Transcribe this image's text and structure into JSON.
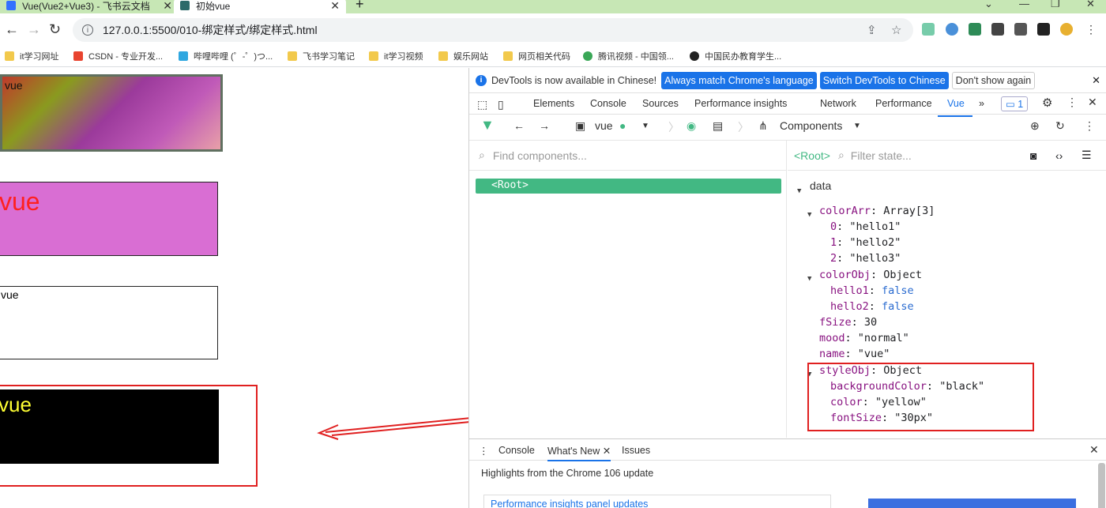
{
  "browser": {
    "tabs": [
      {
        "title": "Vue(Vue2+Vue3) - 飞书云文档",
        "active": false
      },
      {
        "title": "初始vue",
        "active": true
      }
    ],
    "new_tab": "+",
    "url": "127.0.0.1:5500/010-绑定样式/绑定样式.html",
    "bookmarks": [
      "it学习网址",
      "CSDN - 专业开发...",
      "哔哩哔哩 (゜-゜)つ...",
      "飞书学习笔记",
      "it学习视频",
      "娱乐网站",
      "网页相关代码",
      "腾讯视频 - 中国领...",
      "中国民办教育学生..."
    ]
  },
  "page": {
    "boxes": [
      {
        "text": "vue",
        "description": "gradient box"
      },
      {
        "text": "vue",
        "description": "purple box red text"
      },
      {
        "text": "vue",
        "description": "plain bordered box"
      },
      {
        "text": "vue",
        "description": "black box yellow text"
      }
    ],
    "colors": {
      "box2_bg": "#d96ed3",
      "box2_text": "#ff2020",
      "box4_bg": "#000000",
      "box4_text": "#ffff33",
      "highlight_red": "#e02020"
    }
  },
  "devtools": {
    "infobar": {
      "text": "DevTools is now available in Chinese!",
      "btn1": "Always match Chrome's language",
      "btn2": "Switch DevTools to Chinese",
      "btn3": "Don't show again"
    },
    "tabs": [
      "Elements",
      "Console",
      "Sources",
      "Performance insights",
      "Network",
      "Performance",
      "Vue"
    ],
    "active_tab": "Vue",
    "issues_count": "1",
    "vue_toolbar": {
      "app_name": "vue",
      "components_label": "Components"
    },
    "find_placeholder": "Find components...",
    "root_label": "<Root>",
    "selected_label": "<Root>",
    "filter_placeholder": "Filter state...",
    "state": {
      "section": "data",
      "colorArr_key": "colorArr",
      "colorArr_type": "Array[3]",
      "colorArr_items": [
        {
          "idx": "0",
          "val": "\"hello1\""
        },
        {
          "idx": "1",
          "val": "\"hello2\""
        },
        {
          "idx": "2",
          "val": "\"hello3\""
        }
      ],
      "colorObj_key": "colorObj",
      "colorObj_type": "Object",
      "colorObj_items": [
        {
          "key": "hello1",
          "val": "false"
        },
        {
          "key": "hello2",
          "val": "false"
        }
      ],
      "fSize_key": "fSize",
      "fSize_val": "30",
      "mood_key": "mood",
      "mood_val": "\"normal\"",
      "name_key": "name",
      "name_val": "\"vue\"",
      "styleObj_key": "styleObj",
      "styleObj_type": "Object",
      "styleObj_items": [
        {
          "key": "backgroundColor",
          "val": "\"black\""
        },
        {
          "key": "color",
          "val": "\"yellow\""
        },
        {
          "key": "fontSize",
          "val": "\"30px\""
        }
      ]
    },
    "drawer": {
      "tabs": [
        "Console",
        "What's New",
        "Issues"
      ],
      "active_tab": "What's New",
      "headline": "Highlights from the Chrome 106 update",
      "card_title": "Performance insights panel updates"
    }
  }
}
